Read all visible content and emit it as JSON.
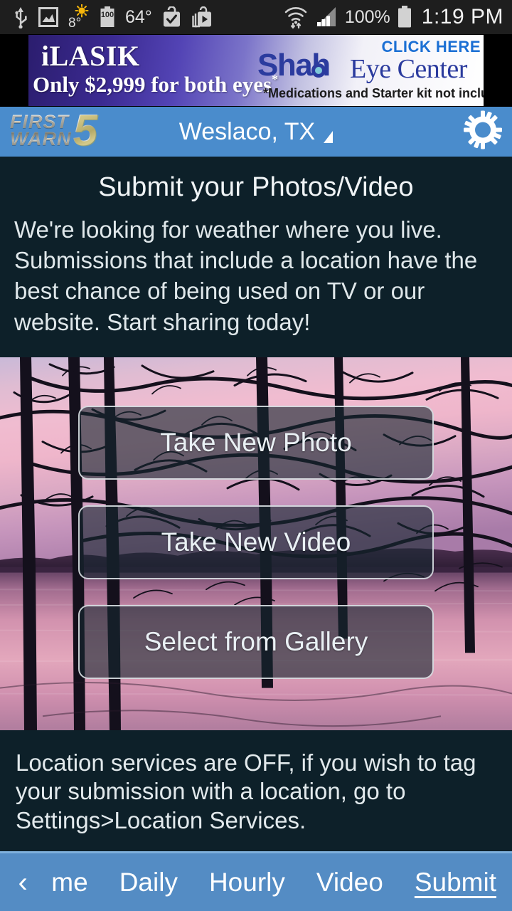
{
  "statusbar": {
    "icons": [
      {
        "name": "usb-icon",
        "glyph": "usb"
      },
      {
        "name": "screenshot-image-icon",
        "glyph": "image"
      },
      {
        "name": "brightness-sun-icon",
        "glyph": "sun"
      },
      {
        "name": "battery-saver-icon",
        "glyph": "battery-100"
      },
      {
        "name": "check-bag-icon",
        "glyph": "bag-check"
      },
      {
        "name": "play-store-bag-icon",
        "glyph": "bag-play"
      },
      {
        "name": "wifi-transfer-icon",
        "glyph": "wifi"
      },
      {
        "name": "cell-signal-icon",
        "glyph": "signal"
      },
      {
        "name": "battery-icon",
        "glyph": "battery-full"
      }
    ],
    "brightness_label": "8°",
    "battery_saver_label": "100",
    "temperature": "64°",
    "battery_percent": "100%",
    "clock": "1:19 PM"
  },
  "ad": {
    "headline": "iLASIK",
    "price_line": "Only $2,999 for both eyes",
    "price_asterisk": "*",
    "brand_first": "Shah",
    "brand_rest": "Eye Center",
    "click_here": "CLICK HERE",
    "disclaimer": "*Medications and Starter kit not included."
  },
  "header": {
    "logo_line1": "FIRST",
    "logo_line2": "WARN",
    "logo_channel": "5",
    "location": "Weslaco, TX",
    "settings_label": "Settings"
  },
  "intro": {
    "title": "Submit your Photos/Video",
    "body": "We're looking for weather where you live. Submissions that include a location have the best chance of being used on TV or our website. Start sharing today!"
  },
  "actions": {
    "take_photo": "Take New Photo",
    "take_video": "Take New Video",
    "select_gallery": "Select from Gallery"
  },
  "location_note": "Location services are OFF, if you wish to tag your submission with a location, go to Settings>Location Services.",
  "bottomnav": {
    "back_glyph": "‹",
    "items": [
      {
        "label": "me",
        "active": false
      },
      {
        "label": "Daily",
        "active": false
      },
      {
        "label": "Hourly",
        "active": false
      },
      {
        "label": "Video",
        "active": false
      },
      {
        "label": "Submit",
        "active": true
      }
    ]
  },
  "colors": {
    "header_blue": "#4a8ccc",
    "nav_blue": "#548cc4",
    "page_dark": "#0d2029",
    "statusbar": "#1e1e1e",
    "text_light": "#e2e9ec"
  }
}
